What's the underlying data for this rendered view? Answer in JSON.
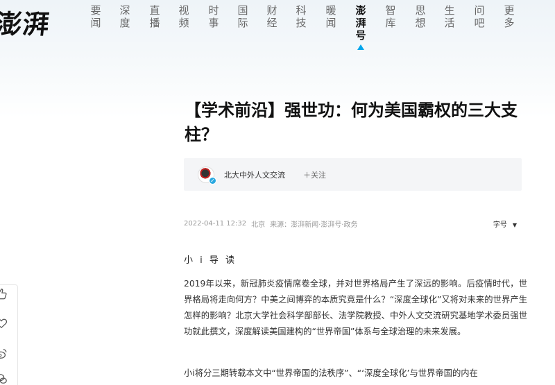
{
  "logo": "澎湃",
  "nav": [
    {
      "label": "要闻",
      "active": false
    },
    {
      "label": "深度",
      "active": false
    },
    {
      "label": "直播",
      "active": false
    },
    {
      "label": "视频",
      "active": false
    },
    {
      "label": "时事",
      "active": false
    },
    {
      "label": "国际",
      "active": false
    },
    {
      "label": "财经",
      "active": false
    },
    {
      "label": "科技",
      "active": false
    },
    {
      "label": "暖闻",
      "active": false
    },
    {
      "label": "澎湃号",
      "active": true
    },
    {
      "label": "智库",
      "active": false
    },
    {
      "label": "思想",
      "active": false
    },
    {
      "label": "生活",
      "active": false
    },
    {
      "label": "问吧",
      "active": false
    },
    {
      "label": "更多",
      "active": false
    }
  ],
  "article": {
    "title": "【学术前沿】强世功：何为美国霸权的三大支柱？",
    "author": "北大中外人文交流",
    "follow_label": "＋关注",
    "date": "2022-04-11 12:32",
    "location": "北京",
    "source": "来源：澎湃新闻·澎湃号·政务",
    "font_size_label": "字号",
    "lead_title": "小 i 导 读",
    "paragraphs": [
      "2019年以来，新冠肺炎疫情席卷全球，并对世界格局产生了深远的影响。后疫情时代，世界格局将走向何方？中美之间博弈的本质究竟是什么？“深度全球化”又将对未来的世界产生怎样的影响？北京大学社会科学部部长、法学院教授、中外人文交流研究基地学术委员强世功就此撰文，深度解读美国建构的“世界帝国”体系与全球治理的未来发展。",
      "小i将分三期转载本文中“世界帝国的法秩序”、“‘深度全球化’与世界帝国的内在"
    ]
  },
  "icons": {
    "like": "thumbs-up-icon",
    "favorite": "heart-icon",
    "share": "weibo-icon",
    "avatar_badge": "verified-badge-icon"
  },
  "colors": {
    "accent": "#00a5eb",
    "title": "#111111",
    "meta": "#9a9a9a"
  }
}
